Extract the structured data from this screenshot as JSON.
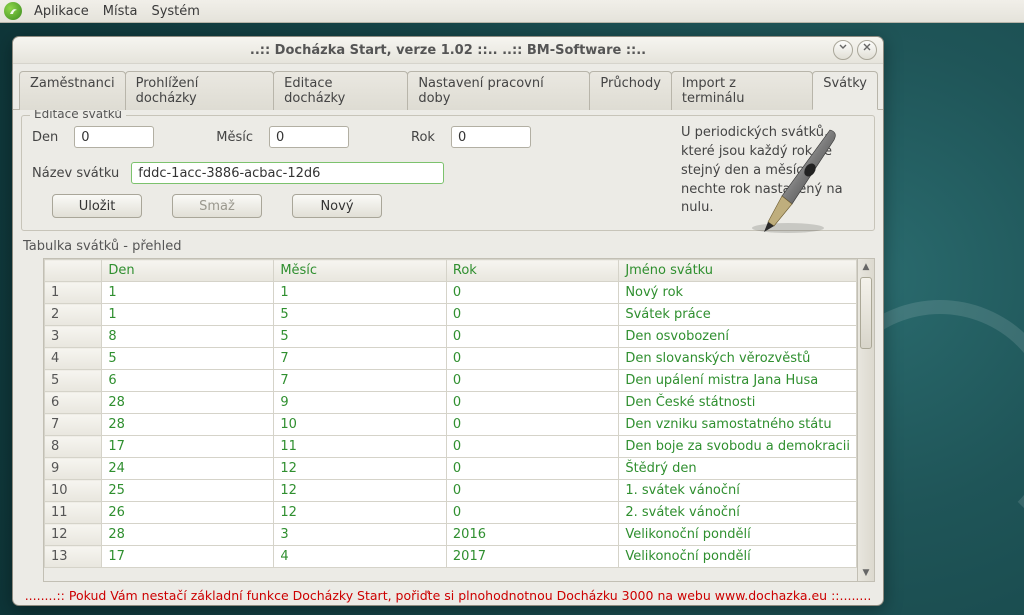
{
  "menubar": {
    "items": [
      "Aplikace",
      "Místa",
      "Systém"
    ]
  },
  "window": {
    "title": "..:: Docházka Start, verze 1.02 ::..       ..:: BM-Software ::.."
  },
  "tabs": [
    "Zaměstnanci",
    "Prohlížení docházky",
    "Editace docházky",
    "Nastavení pracovní doby",
    "Průchody",
    "Import z terminálu",
    "Svátky"
  ],
  "active_tab": 6,
  "editor": {
    "group_title": "Editace svátků",
    "den_label": "Den",
    "den_value": "0",
    "mesic_label": "Měsíc",
    "mesic_value": "0",
    "rok_label": "Rok",
    "rok_value": "0",
    "nazev_label": "Název svátku",
    "nazev_value": "fddc-1acc-3886-acbac-12d6",
    "btn_save": "Uložit",
    "btn_delete": "Smaž",
    "btn_new": "Nový",
    "help_text": "U periodických svátků, které jsou každý rok ve stejný den a měsíc, nechte rok nastavený na nulu."
  },
  "table": {
    "title": "Tabulka svátků - přehled",
    "headers": {
      "den": "Den",
      "mesic": "Měsíc",
      "rok": "Rok",
      "jmeno": "Jméno svátku"
    },
    "rows": [
      {
        "n": "1",
        "den": "1",
        "mesic": "1",
        "rok": "0",
        "jmeno": "Nový rok"
      },
      {
        "n": "2",
        "den": "1",
        "mesic": "5",
        "rok": "0",
        "jmeno": "Svátek práce"
      },
      {
        "n": "3",
        "den": "8",
        "mesic": "5",
        "rok": "0",
        "jmeno": "Den osvobození"
      },
      {
        "n": "4",
        "den": "5",
        "mesic": "7",
        "rok": "0",
        "jmeno": "Den slovanských věrozvěstů"
      },
      {
        "n": "5",
        "den": "6",
        "mesic": "7",
        "rok": "0",
        "jmeno": "Den upálení mistra Jana Husa"
      },
      {
        "n": "6",
        "den": "28",
        "mesic": "9",
        "rok": "0",
        "jmeno": "Den České státnosti"
      },
      {
        "n": "7",
        "den": "28",
        "mesic": "10",
        "rok": "0",
        "jmeno": "Den vzniku samostatného státu"
      },
      {
        "n": "8",
        "den": "17",
        "mesic": "11",
        "rok": "0",
        "jmeno": "Den boje za svobodu a demokracii"
      },
      {
        "n": "9",
        "den": "24",
        "mesic": "12",
        "rok": "0",
        "jmeno": "Štědrý den"
      },
      {
        "n": "10",
        "den": "25",
        "mesic": "12",
        "rok": "0",
        "jmeno": "1. svátek vánoční"
      },
      {
        "n": "11",
        "den": "26",
        "mesic": "12",
        "rok": "0",
        "jmeno": "2. svátek vánoční"
      },
      {
        "n": "12",
        "den": "28",
        "mesic": "3",
        "rok": "2016",
        "jmeno": "Velikonoční pondělí"
      },
      {
        "n": "13",
        "den": "17",
        "mesic": "4",
        "rok": "2017",
        "jmeno": "Velikonoční pondělí"
      }
    ]
  },
  "footer": {
    "prefix": "........::   Pokud Vám nestačí základní funkce Docházky Start, pořiďte si plnohodnotnou Docházku 3000 na webu  ",
    "link": "www.dochazka.eu",
    "suffix": "  ::........"
  }
}
